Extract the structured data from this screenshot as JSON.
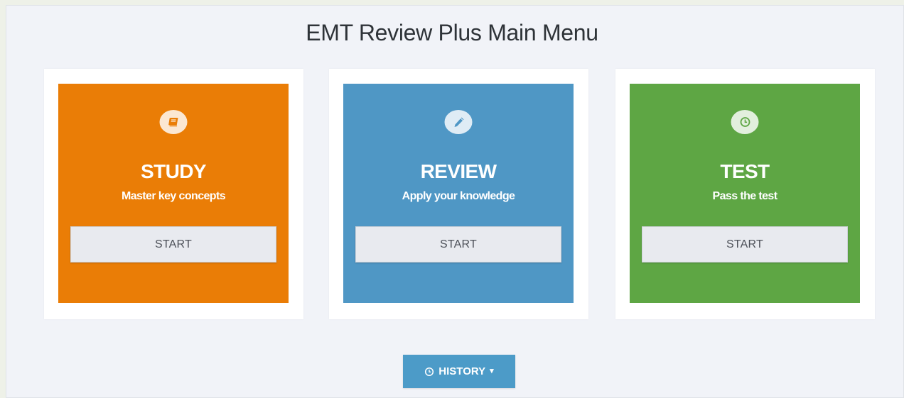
{
  "page": {
    "title": "EMT Review Plus Main Menu"
  },
  "cards": [
    {
      "heading": "STUDY",
      "subtitle": "Master key concepts",
      "button": "START",
      "icon": "book-icon",
      "color": "#ea7d06"
    },
    {
      "heading": "REVIEW",
      "subtitle": "Apply your knowledge",
      "button": "START",
      "icon": "pencil-icon",
      "color": "#4f97c5"
    },
    {
      "heading": "TEST",
      "subtitle": "Pass the test",
      "button": "START",
      "icon": "clock-icon",
      "color": "#5ea644"
    }
  ],
  "history": {
    "label": "HISTORY",
    "icon": "clock-icon",
    "caret_icon": "caret-down-icon",
    "color": "#4c9bc8"
  }
}
